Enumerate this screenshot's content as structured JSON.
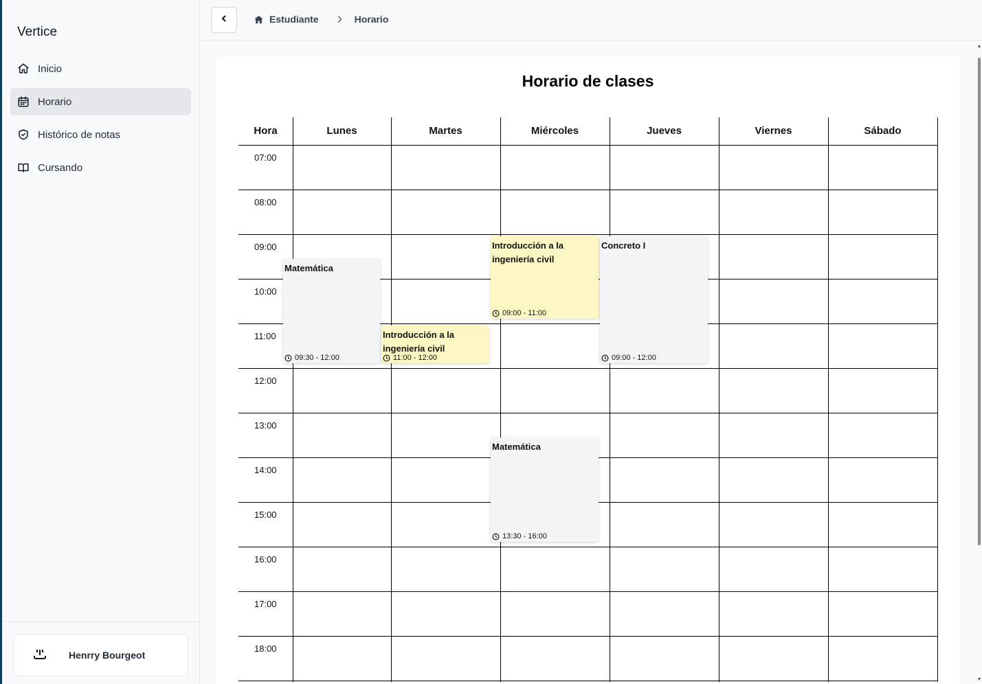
{
  "app": {
    "brand": "Vertice"
  },
  "sidebar": {
    "items": [
      {
        "label": "Inicio",
        "icon": "home-icon",
        "active": false
      },
      {
        "label": "Horario",
        "icon": "calendar-icon",
        "active": true
      },
      {
        "label": "Histórico de notas",
        "icon": "shield-check-icon",
        "active": false
      },
      {
        "label": "Cursando",
        "icon": "book-open-icon",
        "active": false
      }
    ],
    "user": {
      "name": "Henrry Bourgeot",
      "avatar_icon": "face-avatar-icon"
    }
  },
  "topbar": {
    "back_icon": "chevron-left-icon",
    "breadcrumb": [
      {
        "label": "Estudiante",
        "icon": "home-solid-icon"
      },
      {
        "label": "Horario"
      }
    ]
  },
  "schedule": {
    "title": "Horario de clases",
    "columns": [
      "Hora",
      "Lunes",
      "Martes",
      "Miércoles",
      "Jueves",
      "Viernes",
      "Sábado"
    ],
    "hours": [
      "07:00",
      "08:00",
      "09:00",
      "10:00",
      "11:00",
      "12:00",
      "13:00",
      "14:00",
      "15:00",
      "16:00",
      "17:00",
      "18:00"
    ],
    "events": [
      {
        "day": "Lunes",
        "title": "Matemática",
        "time": "09:30 - 12:00",
        "start": 9.5,
        "end": 12,
        "color": "#f3f4f6"
      },
      {
        "day": "Martes",
        "title": "Introducción a la ingeniería civil",
        "time": "11:00 - 12:00",
        "start": 11,
        "end": 12,
        "color": "#fdf7c3"
      },
      {
        "day": "Miércoles",
        "title": "Introducción a la ingeniería civil",
        "time": "09:00 - 11:00",
        "start": 9,
        "end": 11,
        "color": "#fdf7c3"
      },
      {
        "day": "Miércoles",
        "title": "Matemática",
        "time": "13:30 - 16:00",
        "start": 13.5,
        "end": 16,
        "color": "#f3f4f6"
      },
      {
        "day": "Jueves",
        "title": "Concreto I",
        "time": "09:00 - 12:00",
        "start": 9,
        "end": 12,
        "color": "#f3f4f6"
      }
    ]
  }
}
